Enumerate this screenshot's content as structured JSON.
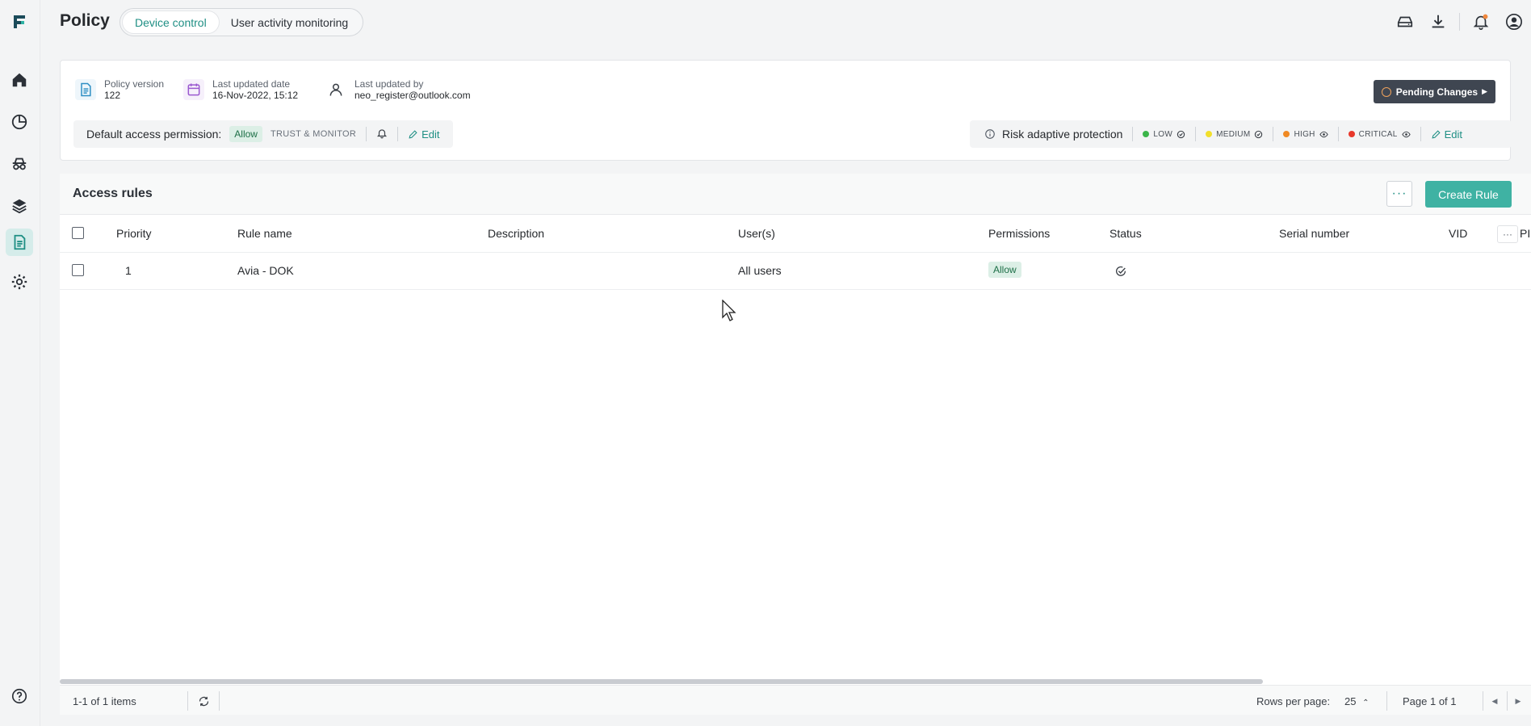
{
  "app": {
    "title": "Policy",
    "tabs": [
      {
        "label": "Device control",
        "active": true
      },
      {
        "label": "User activity monitoring",
        "active": false
      }
    ]
  },
  "sidebar": {
    "items": [
      {
        "name": "home",
        "icon": "home-icon"
      },
      {
        "name": "dashboard",
        "icon": "pie-chart-icon"
      },
      {
        "name": "incognito",
        "icon": "spy-icon"
      },
      {
        "name": "layers",
        "icon": "layers-icon"
      },
      {
        "name": "policy",
        "icon": "document-icon",
        "active": true
      },
      {
        "name": "settings",
        "icon": "gear-icon"
      }
    ],
    "help_icon": "help-icon"
  },
  "header_icons": [
    "drive-icon",
    "download-icon",
    "bell-icon",
    "account-icon"
  ],
  "policy": {
    "version_label": "Policy version",
    "version_value": "122",
    "updated_date_label": "Last updated date",
    "updated_date_value": "16-Nov-2022, 15:12",
    "updated_by_label": "Last updated by",
    "updated_by_value": "neo_register@outlook.com",
    "pending_button": "Pending Changes",
    "default_access_label": "Default access permission:",
    "default_access_value": "Allow",
    "default_access_mode": "TRUST & MONITOR",
    "edit_label": "Edit"
  },
  "risk": {
    "label": "Risk adaptive protection",
    "levels": [
      {
        "label": "LOW",
        "color": "#3cb54a",
        "icon": "check-circle-icon"
      },
      {
        "label": "MEDIUM",
        "color": "#f2df2b",
        "icon": "check-circle-icon"
      },
      {
        "label": "HIGH",
        "color": "#f08a24",
        "icon": "eye-icon"
      },
      {
        "label": "CRITICAL",
        "color": "#e8382b",
        "icon": "eye-icon"
      }
    ],
    "edit_label": "Edit"
  },
  "rules": {
    "title": "Access rules",
    "more_label": "···",
    "create_label": "Create Rule",
    "columns": [
      "Priority",
      "Rule name",
      "Description",
      "User(s)",
      "Permissions",
      "Status",
      "Serial number",
      "VID",
      "PI"
    ],
    "rows": [
      {
        "priority": "1",
        "name": "Avia - DOK",
        "description": "",
        "users": "All users",
        "permission": "Allow",
        "status_icon": "check-circle-icon",
        "serial": "",
        "vid": ""
      }
    ]
  },
  "footer": {
    "count": "1-1 of 1 items",
    "rows_per_page_label": "Rows per page:",
    "rows_per_page_value": "25",
    "page": "Page 1 of 1"
  },
  "colors": {
    "accent": "#1f8f84",
    "create_button": "#3fb2a3",
    "pending_button": "#3f4651"
  }
}
